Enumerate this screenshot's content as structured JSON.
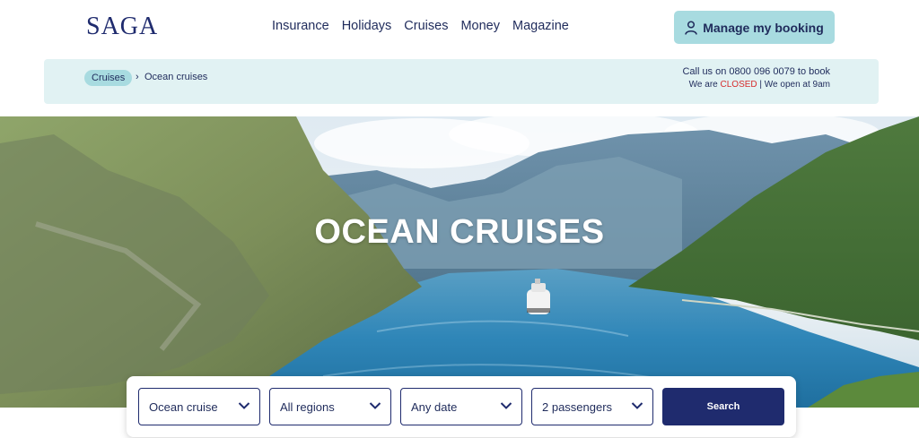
{
  "brand": {
    "logo_text": "SAGA",
    "navy": "#1f2b6e",
    "teal": "#a8dbe0",
    "closed_red": "#d62d2d"
  },
  "nav": {
    "items": [
      {
        "label": "Insurance"
      },
      {
        "label": "Holidays"
      },
      {
        "label": "Cruises"
      },
      {
        "label": "Money"
      },
      {
        "label": "Magazine"
      }
    ]
  },
  "account": {
    "manage_label": "Manage my booking",
    "icon": "person-icon"
  },
  "breadcrumb": {
    "parent": "Cruises",
    "separator": "›",
    "current": "Ocean cruises"
  },
  "contact": {
    "call_prefix": "Call us on",
    "phone": "0800 096 0079",
    "call_suffix": "to book",
    "status_prefix": "We are",
    "status": "CLOSED",
    "status_suffix": "| We open at 9am"
  },
  "hero": {
    "title": "OCEAN CRUISES"
  },
  "search": {
    "type_value": "Ocean cruise",
    "region_value": "All regions",
    "date_value": "Any date",
    "passengers_value": "2 passengers",
    "button_label": "Search"
  }
}
